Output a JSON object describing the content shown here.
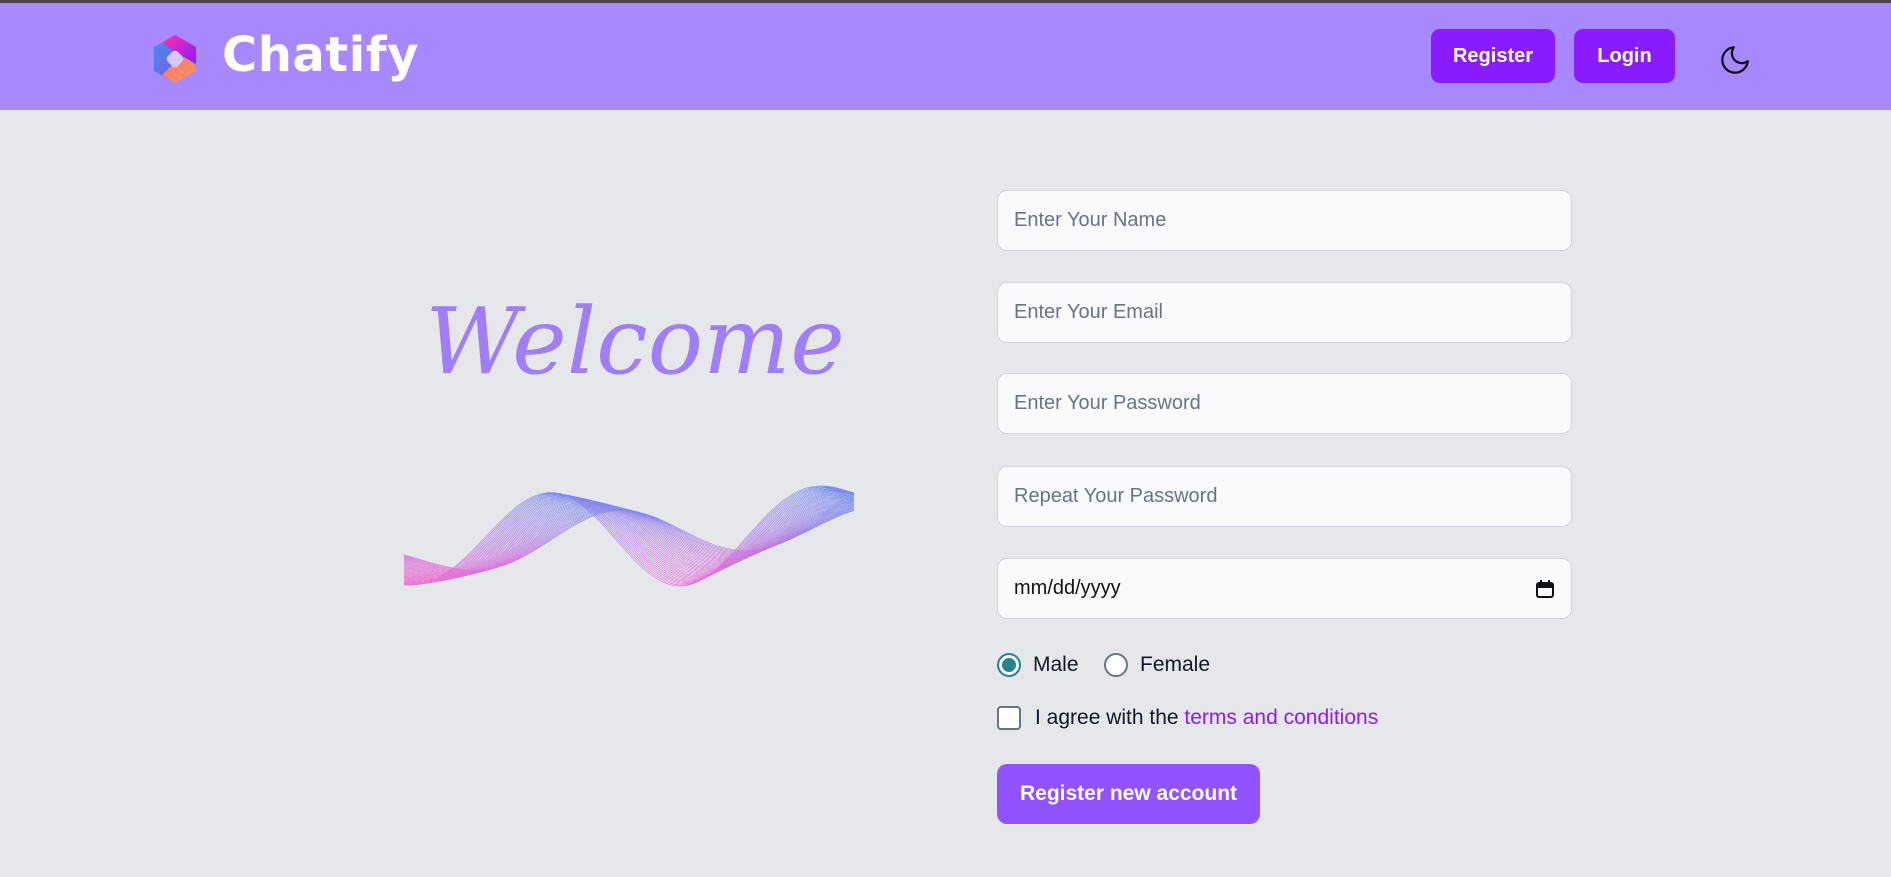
{
  "header": {
    "brand": "Chatify",
    "register_label": "Register",
    "login_label": "Login",
    "theme_icon": "moon-icon"
  },
  "hero": {
    "welcome": "Welcome"
  },
  "form": {
    "name_placeholder": "Enter Your Name",
    "email_placeholder": "Enter Your Email",
    "password_placeholder": "Enter Your Password",
    "repeat_placeholder": "Repeat Your Password",
    "date_placeholder": "mm/dd/yyyy",
    "gender_options": [
      {
        "label": "Male",
        "selected": true
      },
      {
        "label": "Female",
        "selected": false
      }
    ],
    "agree_text": "I agree with the ",
    "terms_link": "terms and conditions",
    "agree_checked": false,
    "submit_label": "Register new account"
  },
  "colors": {
    "header": "#a888ff",
    "accent": "#8a1cff",
    "submit": "#9152ff",
    "welcome": "#a07ef5"
  }
}
